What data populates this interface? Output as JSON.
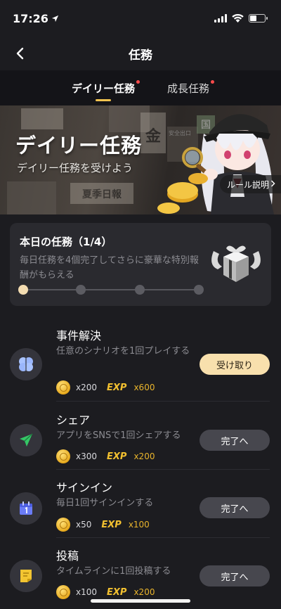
{
  "status_bar": {
    "time": "17:26"
  },
  "nav": {
    "title": "任務"
  },
  "tabs": [
    {
      "label": "デイリー任務",
      "active": true
    },
    {
      "label": "成長任務",
      "active": false
    }
  ],
  "banner": {
    "title": "デイリー任務",
    "subtitle": "デイリー任務を受けよう",
    "rules_label": "ルール説明",
    "sign_texts": [
      "金",
      "安全出口",
      "夏季日報",
      "国"
    ]
  },
  "today": {
    "title": "本日の任務（1/4）",
    "description": "毎日任務を4個完了してさらに豪華な特別報酬がもらえる",
    "progress_done": 1,
    "progress_total": 4
  },
  "tasks": [
    {
      "title": "事件解決",
      "description": "任意のシナリオを1回プレイする",
      "coins": "x200",
      "exp_label": "EXP",
      "exp": "x600",
      "button": "受け取り",
      "state": "claim",
      "icon": "brain-icon"
    },
    {
      "title": "シェア",
      "description": "アプリをSNSで1回シェアする",
      "coins": "x300",
      "exp_label": "EXP",
      "exp": "x200",
      "button": "完了へ",
      "state": "go",
      "icon": "paper-plane-icon"
    },
    {
      "title": "サインイン",
      "description": "毎日1回サインインする",
      "coins": "x50",
      "exp_label": "EXP",
      "exp": "x100",
      "button": "完了へ",
      "state": "go",
      "icon": "calendar-icon"
    },
    {
      "title": "投稿",
      "description": "タイムラインに1回投稿する",
      "coins": "x100",
      "exp_label": "EXP",
      "exp": "x200",
      "button": "完了へ",
      "state": "go",
      "icon": "note-icon"
    }
  ],
  "colors": {
    "accent": "#f2c34f",
    "claim_button": "#f8e0ad",
    "go_button": "#47474e",
    "exp": "#f2c030"
  }
}
